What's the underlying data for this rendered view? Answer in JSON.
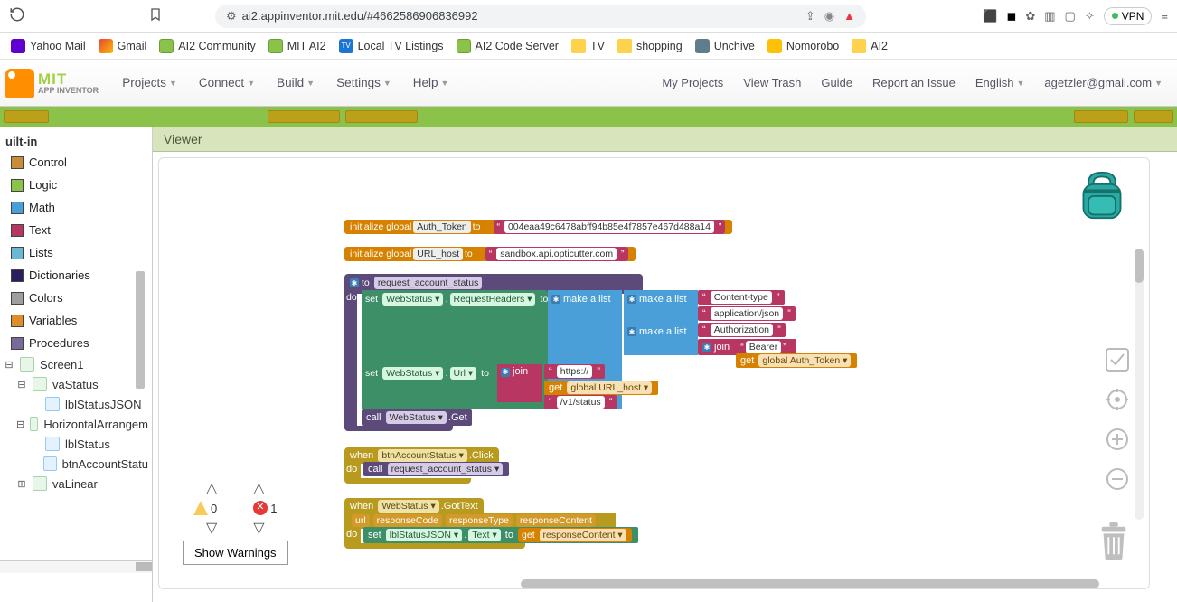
{
  "browser": {
    "url": "ai2.appinventor.mit.edu/#4662586906836992",
    "vpn": "VPN"
  },
  "bookmarks": [
    "Yahoo Mail",
    "Gmail",
    "AI2 Community",
    "MIT AI2",
    "Local TV Listings",
    "AI2 Code Server",
    "TV",
    "shopping",
    "Unchive",
    "Nomorobo",
    "AI2"
  ],
  "logo": {
    "mit": "MIT",
    "ai": "APP INVENTOR"
  },
  "menu_left": [
    "Projects",
    "Connect",
    "Build",
    "Settings",
    "Help"
  ],
  "menu_right": [
    "My Projects",
    "View Trash",
    "Guide",
    "Report an Issue",
    "English",
    "agetzler@gmail.com"
  ],
  "palette": {
    "builtin": "uilt-in",
    "cats": [
      {
        "name": "Control",
        "color": "#c88d36"
      },
      {
        "name": "Logic",
        "color": "#8bc34a"
      },
      {
        "name": "Math",
        "color": "#4a9fd8"
      },
      {
        "name": "Text",
        "color": "#b73662"
      },
      {
        "name": "Lists",
        "color": "#6bb8d6"
      },
      {
        "name": "Dictionaries",
        "color": "#2b1e5e"
      },
      {
        "name": "Colors",
        "color": "#9e9e9e"
      },
      {
        "name": "Variables",
        "color": "#e08c2b"
      },
      {
        "name": "Procedures",
        "color": "#7a6a99"
      }
    ],
    "tree": [
      {
        "t": "Screen1",
        "icon": "screen",
        "ind": 0,
        "exp": "⊟"
      },
      {
        "t": "vaStatus",
        "icon": "va",
        "ind": 1,
        "exp": "⊟"
      },
      {
        "t": "lblStatusJSON",
        "icon": "lbl",
        "ind": 2
      },
      {
        "t": "HorizontalArrangem",
        "icon": "ha",
        "ind": 1,
        "exp": "⊟",
        "expx": -3
      },
      {
        "t": "lblStatus",
        "icon": "lbl",
        "ind": 2
      },
      {
        "t": "btnAccountStatu",
        "icon": "btn",
        "ind": 2
      },
      {
        "t": "vaLinear",
        "icon": "va",
        "ind": 1,
        "exp": "⊞"
      }
    ]
  },
  "viewer_title": "Viewer",
  "warnings": {
    "warn": "0",
    "err": "1",
    "btn": "Show Warnings"
  },
  "blocks": {
    "init_auth": {
      "kw": "initialize global",
      "name": "Auth_Token",
      "to": "to",
      "val": "004eaa49c6478abff94b85e4f7857e467d488a14"
    },
    "init_url": {
      "kw": "initialize global",
      "name": "URL_host",
      "to": "to",
      "val": "sandbox.api.opticutter.com"
    },
    "proc": {
      "to": "to",
      "name": "request_account_status",
      "do": "do",
      "set1": {
        "set": "set",
        "comp": "WebStatus",
        "prop": "RequestHeaders",
        "to": "to"
      },
      "ml1": "make a list",
      "ml2": "make a list",
      "ml3": "make a list",
      "ct": "Content-type",
      "aj": "application/json",
      "auth": "Authorization",
      "join": "join",
      "bearer": "Bearer ",
      "get": "get",
      "gat": "global Auth_Token",
      "set2": {
        "set": "set",
        "comp": "WebStatus",
        "prop": "Url",
        "to": "to"
      },
      "join2": "join",
      "https": "https://",
      "get2": "get",
      "guh": "global URL_host",
      "v1": "/v1/status",
      "call": "call",
      "callc": "WebStatus",
      "callm": ".Get"
    },
    "click": {
      "when": "when",
      "comp": "btnAccountStatus",
      "evt": ".Click",
      "do": "do",
      "call": "call",
      "proc": "request_account_status"
    },
    "got": {
      "when": "when",
      "comp": "WebStatus",
      "evt": ".GotText",
      "do": "do",
      "p": [
        "url",
        "responseCode",
        "responseType",
        "responseContent"
      ],
      "set": "set",
      "comp2": "lblStatusJSON",
      "prop": "Text",
      "to": "to",
      "get": "get",
      "rc": "responseContent"
    }
  }
}
